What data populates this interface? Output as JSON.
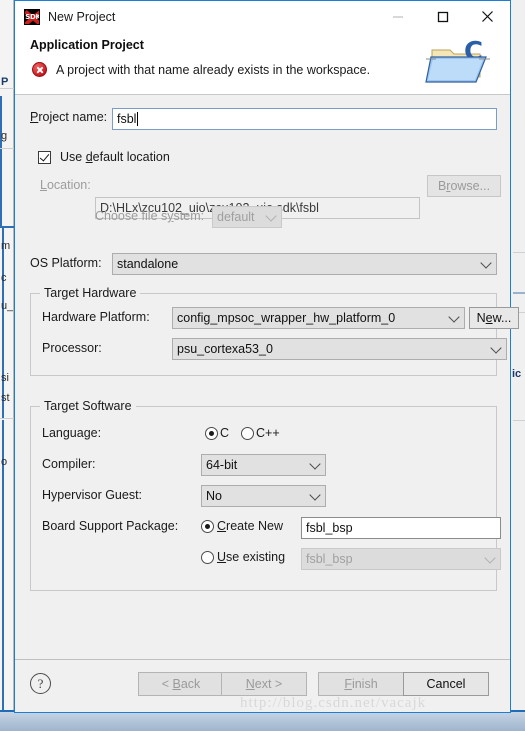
{
  "window": {
    "title": "New Project",
    "app_icon": "sdk-icon",
    "icon_label": "SDK",
    "controls": {
      "minimize": "minimize-icon",
      "maximize": "maximize-icon",
      "close": "close-icon"
    }
  },
  "header": {
    "title": "Application Project",
    "message": "A project with that name already exists in the workspace.",
    "status_icon": "error-icon",
    "banner_icon": "c-project-folder-icon",
    "error_color": "#c4141b"
  },
  "form": {
    "project_name": {
      "label_pre": "P",
      "label_post": "roject name:",
      "value": "fsbl"
    },
    "use_default_location": {
      "label_pre": "Use ",
      "label_mnemonic": "d",
      "label_post": "efault location",
      "checked": true
    },
    "location": {
      "label_pre": "L",
      "label_post": "ocation:",
      "value": "D:\\HLx\\zcu102_uio\\zcu102_uio.sdk\\fsbl",
      "browse_label_pre": "B",
      "browse_label_mnemonic": "r",
      "browse_label_post": "owse...",
      "enabled": false
    },
    "choose_file_system": {
      "label_pre": "Choose file s",
      "label_mnemonic": "y",
      "label_post": "stem:",
      "value": "default",
      "enabled": false
    },
    "os_platform": {
      "label": "OS Platform:",
      "value": "standalone"
    }
  },
  "target_hardware": {
    "group_title": "Target Hardware",
    "hardware_platform": {
      "label": "Hardware Platform:",
      "value": "config_mpsoc_wrapper_hw_platform_0"
    },
    "new_button": {
      "label_pre": "N",
      "label_mnemonic": "e",
      "label_post": "w..."
    },
    "processor": {
      "label": "Processor:",
      "value": "psu_cortexa53_0"
    }
  },
  "target_software": {
    "group_title": "Target Software",
    "language": {
      "label": "Language:",
      "options": [
        "C",
        "C++"
      ],
      "selected": "C"
    },
    "compiler": {
      "label": "Compiler:",
      "value": "64-bit"
    },
    "hypervisor_guest": {
      "label": "Hypervisor Guest:",
      "value": "No"
    },
    "board_support_package": {
      "label": "Board Support Package:",
      "create_new": {
        "label_pre": "C",
        "label_post": "reate New",
        "selected": true,
        "value": "fsbl_bsp"
      },
      "use_existing": {
        "label_pre": "U",
        "label_post": "se existing",
        "selected": false,
        "value": "fsbl_bsp"
      }
    }
  },
  "footer": {
    "help_icon": "help-icon",
    "help_glyph": "?",
    "buttons": [
      {
        "label_pre": "< ",
        "label_mnemonic": "B",
        "label_post": "ack",
        "enabled": false
      },
      {
        "label_pre": "",
        "label_mnemonic": "N",
        "label_post": "ext >",
        "enabled": false
      },
      {
        "label_pre": "",
        "label_mnemonic": "F",
        "label_post": "inish",
        "enabled": false
      },
      {
        "label_pre": "",
        "label_mnemonic": "",
        "label_post": "Cancel",
        "enabled": true
      }
    ]
  },
  "watermark": {
    "text": "http://blog.csdn.net/vacajk"
  },
  "backdrop": {
    "fragments": [
      "P",
      "g",
      "m",
      "c",
      "u_",
      "si",
      "st",
      "o",
      "ic"
    ]
  }
}
